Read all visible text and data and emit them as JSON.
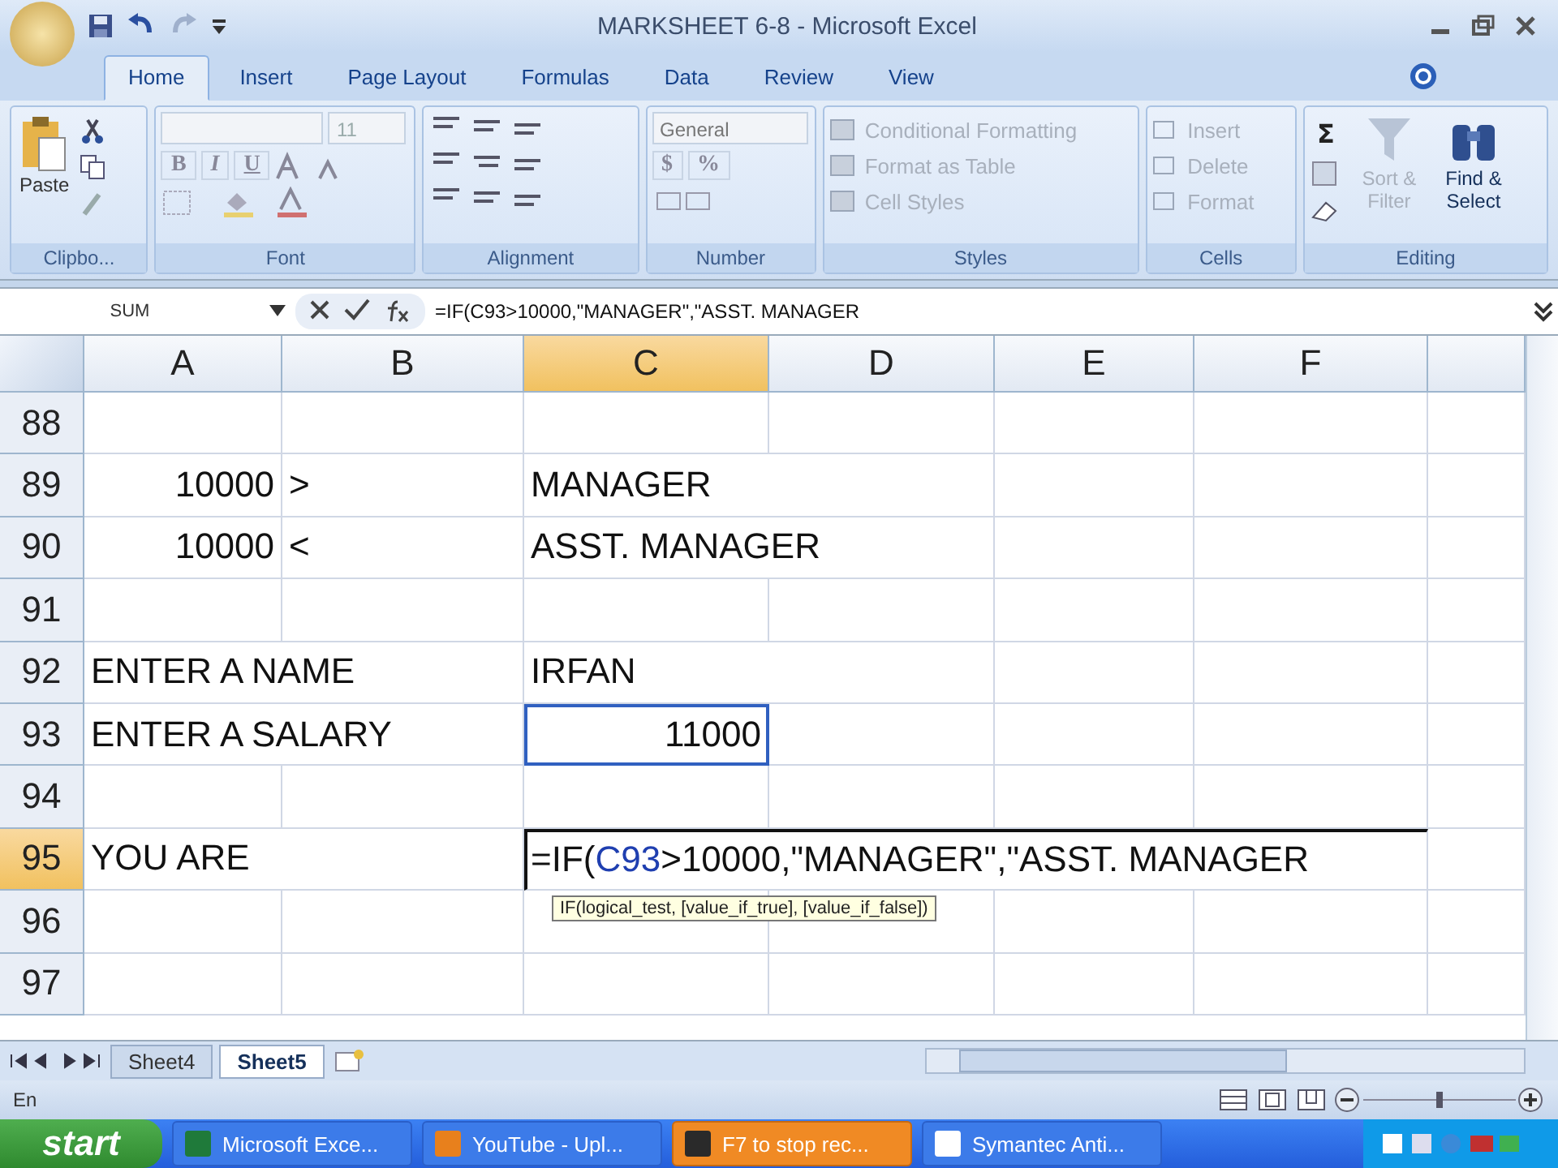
{
  "window": {
    "title": "MARKSHEET 6-8 - Microsoft Excel"
  },
  "tabs": [
    {
      "label": "Home",
      "selected": true
    },
    {
      "label": "Insert",
      "selected": false
    },
    {
      "label": "Page Layout",
      "selected": false
    },
    {
      "label": "Formulas",
      "selected": false
    },
    {
      "label": "Data",
      "selected": false
    },
    {
      "label": "Review",
      "selected": false
    },
    {
      "label": "View",
      "selected": false
    }
  ],
  "ribbon": {
    "clipboard": {
      "label": "Clipbo...",
      "paste": "Paste"
    },
    "font": {
      "label": "Font",
      "font_size": "11",
      "format_buttons": [
        "B",
        "I",
        "U"
      ]
    },
    "alignment": {
      "label": "Alignment"
    },
    "number": {
      "label": "Number",
      "format": "General",
      "currency": "$",
      "percent": "%"
    },
    "styles": {
      "label": "Styles",
      "commands": [
        {
          "label": "Conditional Formatting",
          "disabled": true
        },
        {
          "label": "Format as Table",
          "disabled": true
        },
        {
          "label": "Cell Styles",
          "disabled": true
        }
      ]
    },
    "cells": {
      "label": "Cells",
      "commands": [
        {
          "label": "Insert",
          "disabled": true
        },
        {
          "label": "Delete",
          "disabled": true
        },
        {
          "label": "Format",
          "disabled": true
        }
      ]
    },
    "editing": {
      "label": "Editing",
      "sum": "Σ",
      "sort": {
        "label": "Sort & Filter",
        "disabled": true
      },
      "find": {
        "label": "Find & Select",
        "disabled": false
      }
    }
  },
  "formula_bar": {
    "name_box": "SUM",
    "formula": "=IF(C93>10000,\"MANAGER\",\"ASST. MANAGER"
  },
  "columns": [
    {
      "label": "A",
      "selected": false
    },
    {
      "label": "B",
      "selected": false
    },
    {
      "label": "C",
      "selected": true
    },
    {
      "label": "D",
      "selected": false
    },
    {
      "label": "E",
      "selected": false
    },
    {
      "label": "F",
      "selected": false
    }
  ],
  "rows": [
    {
      "number": "88",
      "selected": false,
      "cells": [
        {
          "selected": false
        },
        {
          "selected": false
        },
        {
          "selected": false
        },
        {
          "selected": false
        },
        {
          "selected": false
        },
        {
          "selected": false
        }
      ]
    },
    {
      "number": "89",
      "selected": false,
      "cells": [
        {
          "text": "10000",
          "selected": false
        },
        {
          "text": ">",
          "selected": false
        },
        {
          "text": "MANAGER",
          "selected": false
        },
        {
          "selected": false
        },
        {
          "selected": false
        },
        {
          "selected": false
        }
      ]
    },
    {
      "number": "90",
      "selected": false,
      "cells": [
        {
          "text": "10000",
          "selected": false
        },
        {
          "text": "<",
          "selected": false
        },
        {
          "text": "ASST. MANAGER",
          "selected": false
        },
        {
          "selected": false
        },
        {
          "selected": false
        },
        {
          "selected": false
        }
      ]
    },
    {
      "number": "91",
      "selected": false,
      "cells": [
        {
          "selected": false
        },
        {
          "selected": false
        },
        {
          "selected": false
        },
        {
          "selected": false
        },
        {
          "selected": false
        },
        {
          "selected": false
        }
      ]
    },
    {
      "number": "92",
      "selected": false,
      "cells": [
        {
          "text": "ENTER A NAME",
          "selected": false
        },
        {
          "selected": false
        },
        {
          "text": "IRFAN",
          "selected": false
        },
        {
          "selected": false
        },
        {
          "selected": false
        },
        {
          "selected": false
        }
      ]
    },
    {
      "number": "93",
      "selected": false,
      "cells": [
        {
          "text": "ENTER A SALARY",
          "selected": false
        },
        {
          "selected": false
        },
        {
          "text": "11000",
          "selected": true
        },
        {
          "selected": false
        },
        {
          "selected": false
        },
        {
          "selected": false
        }
      ]
    },
    {
      "number": "94",
      "selected": false,
      "cells": [
        {
          "selected": false
        },
        {
          "selected": false
        },
        {
          "selected": false
        },
        {
          "selected": false
        },
        {
          "selected": false
        },
        {
          "selected": false
        }
      ]
    },
    {
      "number": "95",
      "selected": true,
      "cells": [
        {
          "text": "YOU ARE",
          "selected": false
        },
        {
          "selected": false
        }
      ],
      "editing": [
        {
          "kind": "text",
          "text": "=IF("
        },
        {
          "kind": "ref",
          "text": "C93"
        },
        {
          "kind": "text",
          "text": ">10000,\"MANAGER\",\"ASST. MANAGER"
        }
      ]
    },
    {
      "number": "96",
      "selected": false,
      "cells": [
        {
          "selected": false
        },
        {
          "selected": false
        },
        {
          "selected": false
        },
        {
          "selected": false
        },
        {
          "selected": false
        },
        {
          "selected": false
        }
      ]
    },
    {
      "number": "97",
      "selected": false,
      "cells": [
        {
          "selected": false
        },
        {
          "selected": false
        },
        {
          "selected": false
        },
        {
          "selected": false
        },
        {
          "selected": false
        },
        {
          "selected": false
        }
      ]
    }
  ],
  "tooltip": "IF(logical_test, [value_if_true], [value_if_false])",
  "sheets": [
    {
      "label": "Sheet4",
      "selected": false
    },
    {
      "label": "Sheet5",
      "selected": true
    }
  ],
  "status_bar": {
    "mode": "En"
  },
  "taskbar": {
    "start": "start",
    "items": [
      {
        "label": "Microsoft Exce...",
        "highlighted": false
      },
      {
        "label": "YouTube - Upl...",
        "highlighted": false
      },
      {
        "label": "F7 to stop rec...",
        "highlighted": true
      },
      {
        "label": "Symantec Anti...",
        "highlighted": false
      }
    ]
  }
}
